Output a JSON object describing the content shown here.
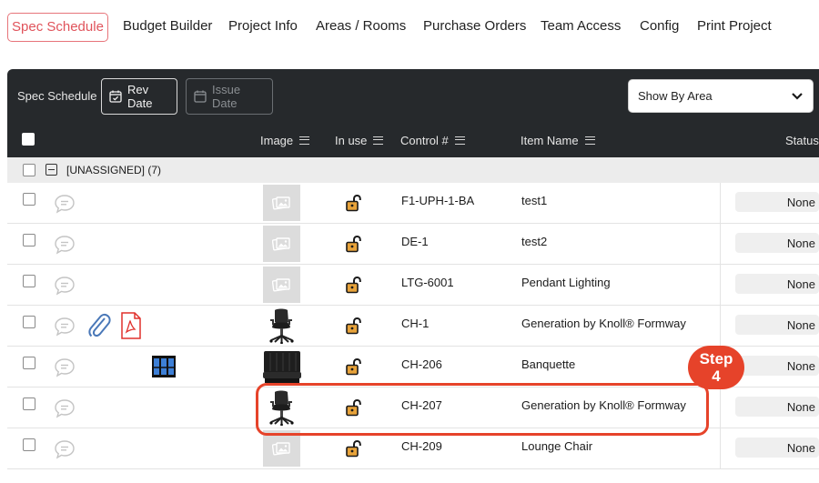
{
  "nav": {
    "items": [
      {
        "label": "Spec Schedule",
        "active": true
      },
      {
        "label": "Budget Builder"
      },
      {
        "label": "Project Info"
      },
      {
        "label": "Areas / Rooms"
      },
      {
        "label": "Purchase Orders"
      },
      {
        "label": "Team Access"
      },
      {
        "label": "Config"
      },
      {
        "label": "Print Project"
      }
    ]
  },
  "toolbar": {
    "title": "Spec Schedule",
    "rev_date_label": "Rev Date",
    "issue_date_label": "Issue Date",
    "show_by": "Show By Area"
  },
  "columns": {
    "image": "Image",
    "in_use": "In use",
    "control": "Control #",
    "item_name": "Item Name",
    "status": "Status"
  },
  "group": {
    "label": "[UNASSIGNED] (7)"
  },
  "rows": [
    {
      "control": "F1-UPH-1-BA",
      "item_name": "test1",
      "status": "None",
      "image": "placeholder-icon"
    },
    {
      "control": "DE-1",
      "item_name": "test2",
      "status": "None",
      "image": "placeholder-icon"
    },
    {
      "control": "LTG-6001",
      "item_name": "Pendant Lighting",
      "status": "None",
      "image": "placeholder-icon"
    },
    {
      "control": "CH-1",
      "item_name": "Generation by Knoll® Formway",
      "status": "None",
      "image": "office-chair",
      "attachments": [
        "paperclip-icon",
        "pdf-icon"
      ]
    },
    {
      "control": "CH-206",
      "item_name": "Banquette",
      "status": "None",
      "image": "banquette",
      "attachments": [
        "binders-icon"
      ]
    },
    {
      "control": "CH-207",
      "item_name": "Generation by Knoll® Formway",
      "status": "None",
      "image": "office-chair"
    },
    {
      "control": "CH-209",
      "item_name": "Lounge Chair",
      "status": "None",
      "image": "placeholder-icon"
    }
  ],
  "annotation": {
    "step_label_1": "Step",
    "step_label_2": "4",
    "color": "#e6432a"
  },
  "colors": {
    "accent": "#e0535b",
    "toolbar_bg": "#26292c",
    "lock_fill": "#e8a33a"
  }
}
